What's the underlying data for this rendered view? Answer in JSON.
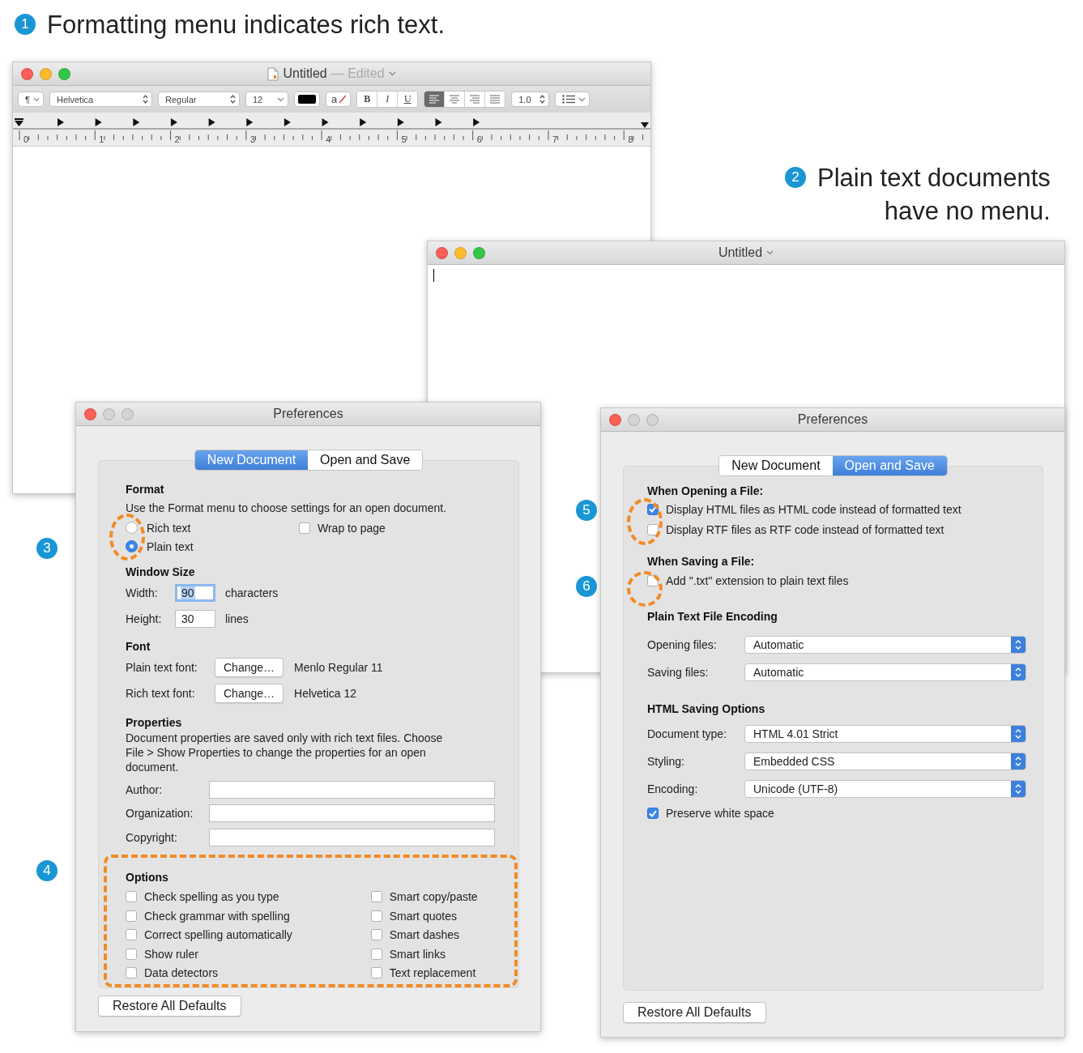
{
  "callouts": [
    {
      "number": "1",
      "lines": [
        "Formatting menu indicates rich text."
      ]
    },
    {
      "number": "2",
      "lines": [
        "Plain text documents",
        "have no menu."
      ]
    }
  ],
  "markers": [
    "3",
    "4",
    "5",
    "6"
  ],
  "rich_window": {
    "title": "Untitled",
    "status": "— Edited",
    "controls_active": true,
    "toolbar": {
      "paragraph": "¶",
      "font": "Helvetica",
      "style": "Regular",
      "size": "12",
      "highlight": "a",
      "bold": "B",
      "italic": "I",
      "underline": "U",
      "alignments": [
        {
          "kind": "left",
          "selected": true
        },
        {
          "kind": "center",
          "selected": false
        },
        {
          "kind": "right",
          "selected": false
        },
        {
          "kind": "justify",
          "selected": false
        }
      ],
      "spacing": "1.0"
    },
    "ruler": [
      "0",
      "1",
      "2",
      "3",
      "4",
      "5",
      "6",
      "7",
      "8"
    ]
  },
  "plain_window": {
    "title": "Untitled",
    "controls_active": true
  },
  "prefs_new": {
    "title": "Preferences",
    "controls_active": false,
    "tabs": [
      {
        "label": "New Document",
        "selected": true
      },
      {
        "label": "Open and Save",
        "selected": false
      }
    ],
    "format": {
      "heading": "Format",
      "description": "Use the Format menu to choose settings for an open document.",
      "radios": [
        {
          "label": "Rich text",
          "selected": false
        },
        {
          "label": "Plain text",
          "selected": true
        }
      ],
      "wrap": {
        "label": "Wrap to page",
        "checked": false
      }
    },
    "window_size": {
      "heading": "Window Size",
      "fields": [
        {
          "label": "Width:",
          "value": "90",
          "unit": "characters",
          "focused": true
        },
        {
          "label": "Height:",
          "value": "30",
          "unit": "lines",
          "focused": false
        }
      ]
    },
    "font": {
      "heading": "Font",
      "rows": [
        {
          "label": "Plain text font:",
          "button": "Change…",
          "value": "Menlo Regular 11"
        },
        {
          "label": "Rich text font:",
          "button": "Change…",
          "value": "Helvetica 12"
        }
      ]
    },
    "properties": {
      "heading": "Properties",
      "description": "Document properties are saved only with rich text files. Choose File > Show Properties to change the properties for an open document.",
      "fields": [
        {
          "label": "Author:"
        },
        {
          "label": "Organization:"
        },
        {
          "label": "Copyright:"
        }
      ]
    },
    "options": {
      "heading": "Options",
      "columns": [
        [
          {
            "label": "Check spelling as you type",
            "checked": false
          },
          {
            "label": "Check grammar with spelling",
            "checked": false
          },
          {
            "label": "Correct spelling automatically",
            "checked": false
          },
          {
            "label": "Show ruler",
            "checked": false
          },
          {
            "label": "Data detectors",
            "checked": false
          }
        ],
        [
          {
            "label": "Smart copy/paste",
            "checked": false
          },
          {
            "label": "Smart quotes",
            "checked": false
          },
          {
            "label": "Smart dashes",
            "checked": false
          },
          {
            "label": "Smart links",
            "checked": false
          },
          {
            "label": "Text replacement",
            "checked": false
          }
        ]
      ]
    },
    "restore": "Restore All Defaults"
  },
  "prefs_open": {
    "title": "Preferences",
    "controls_active": false,
    "tabs": [
      {
        "label": "New Document",
        "selected": false
      },
      {
        "label": "Open and Save",
        "selected": true
      }
    ],
    "opening": {
      "heading": "When Opening a File:",
      "checks": [
        {
          "label": "Display HTML files as HTML code instead of formatted text",
          "checked": true
        },
        {
          "label": "Display RTF files as RTF code instead of formatted text",
          "checked": false
        }
      ]
    },
    "saving": {
      "heading": "When Saving a File:",
      "checks": [
        {
          "label": "Add \".txt\" extension to plain text files",
          "checked": false
        }
      ]
    },
    "encoding": {
      "heading": "Plain Text File Encoding",
      "selects": [
        {
          "label": "Opening files:",
          "value": "Automatic"
        },
        {
          "label": "Saving files:",
          "value": "Automatic"
        }
      ]
    },
    "html": {
      "heading": "HTML Saving Options",
      "selects": [
        {
          "label": "Document type:",
          "value": "HTML 4.01 Strict"
        },
        {
          "label": "Styling:",
          "value": "Embedded CSS"
        },
        {
          "label": "Encoding:",
          "value": "Unicode (UTF-8)"
        }
      ],
      "checks": [
        {
          "label": "Preserve white space",
          "checked": true
        }
      ]
    },
    "restore": "Restore All Defaults"
  }
}
